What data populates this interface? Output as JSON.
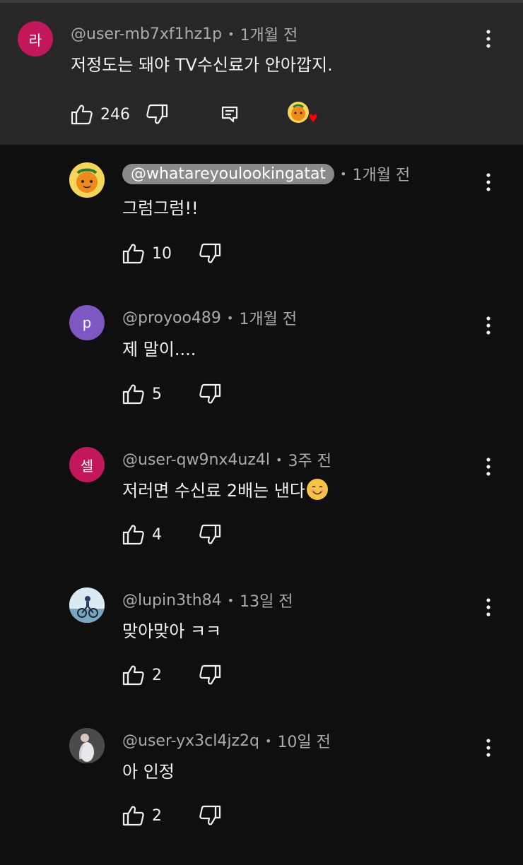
{
  "parent": {
    "avatar_letter": "라",
    "avatar_color": "#c2185b",
    "handle": "@user-mb7xf1hz1p",
    "time": "1개월 전",
    "text": "저정도는 돼야 TV수신료가 안아깝지.",
    "likes": "246"
  },
  "replies": [
    {
      "handle": "@whatareyoulookingatat",
      "time": "1개월 전",
      "text": "그럼그럼!!",
      "likes": "10",
      "avatar": "orange-character"
    },
    {
      "handle": "@proyoo489",
      "time": "1개월 전",
      "text": "제 말이....",
      "likes": "5",
      "avatar_letter": "p",
      "avatar_color": "#7e57c2"
    },
    {
      "handle": "@user-qw9nx4uz4l",
      "time": "3주 전",
      "text": "저러면 수신료 2배는 낸다",
      "likes": "4",
      "avatar_letter": "셀",
      "avatar_color": "#c2185b",
      "emoji": "smiling-face"
    },
    {
      "handle": "@lupin3th84",
      "time": "13일 전",
      "text": "맞아맞아 ㅋㅋ",
      "likes": "2",
      "avatar": "cyclist-photo"
    },
    {
      "handle": "@user-yx3cl4jz2q",
      "time": "10일 전",
      "text": "아 인정",
      "likes": "2",
      "avatar": "person-photo"
    }
  ]
}
